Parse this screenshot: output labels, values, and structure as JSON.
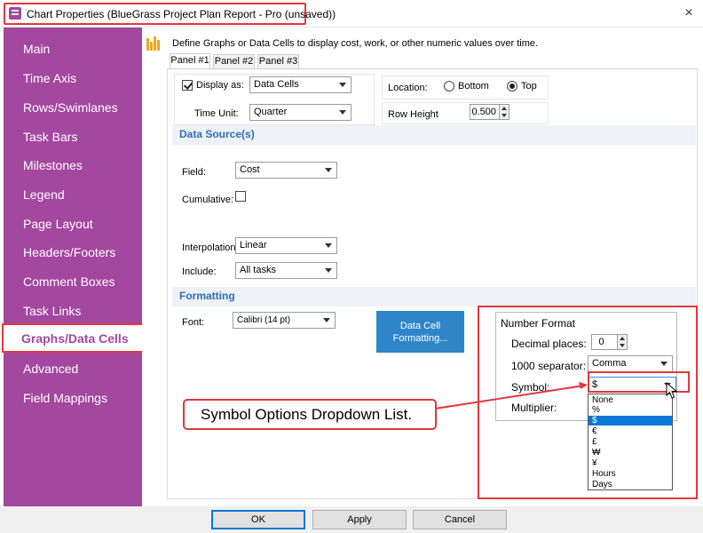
{
  "window": {
    "title": "Chart Properties (BlueGrass Project Plan Report - Pro (unsaved))",
    "close": "×"
  },
  "sidebar": {
    "items": [
      "Main",
      "Time Axis",
      "Rows/Swimlanes",
      "Task Bars",
      "Milestones",
      "Legend",
      "Page Layout",
      "Headers/Footers",
      "Comment Boxes",
      "Task Links",
      "Graphs/Data Cells",
      "Advanced",
      "Field Mappings"
    ],
    "active": "Graphs/Data Cells"
  },
  "header": {
    "description": "Define Graphs or Data Cells to display cost, work, or other numeric values over time."
  },
  "tabs": [
    "Panel #1",
    "Panel #2",
    "Panel #3"
  ],
  "panel": {
    "display_as_label": "Display as:",
    "display_as_value": "Data Cells",
    "display_as_checked": true,
    "time_unit_label": "Time Unit:",
    "time_unit_value": "Quarter",
    "location_label": "Location:",
    "location_bottom": "Bottom",
    "location_top": "Top",
    "location_selected": "Top",
    "row_height_label": "Row Height",
    "row_height_value": "0.500"
  },
  "data_source": {
    "heading": "Data Source(s)",
    "field_label": "Field:",
    "field_value": "Cost",
    "cumulative_label": "Cumulative:",
    "cumulative_checked": false,
    "interpolation_label": "Interpolation:",
    "interpolation_value": "Linear",
    "include_label": "Include:",
    "include_value": "All tasks"
  },
  "formatting": {
    "heading": "Formatting",
    "font_label": "Font:",
    "font_value": "Calibri (14 pt)",
    "data_cell_button": "Data Cell Formatting..."
  },
  "number_format": {
    "title": "Number Format",
    "decimal_label": "Decimal places:",
    "decimal_value": "0",
    "separator_label": "1000 separator:",
    "separator_value": "Comma",
    "symbol_label": "Symbol:",
    "symbol_value": "$",
    "multiplier_label": "Multiplier:",
    "symbol_options": [
      "None",
      "%",
      "$",
      "€",
      "£",
      "₩",
      "¥",
      "Hours",
      "Days"
    ],
    "symbol_selected": "$"
  },
  "callout": {
    "text": "Symbol Options Dropdown List."
  },
  "buttons": {
    "ok": "OK",
    "apply": "Apply",
    "cancel": "Cancel"
  },
  "colors": {
    "sidebar": "#a3479f",
    "highlight": "#e0393b",
    "accent": "#2e86c9"
  }
}
